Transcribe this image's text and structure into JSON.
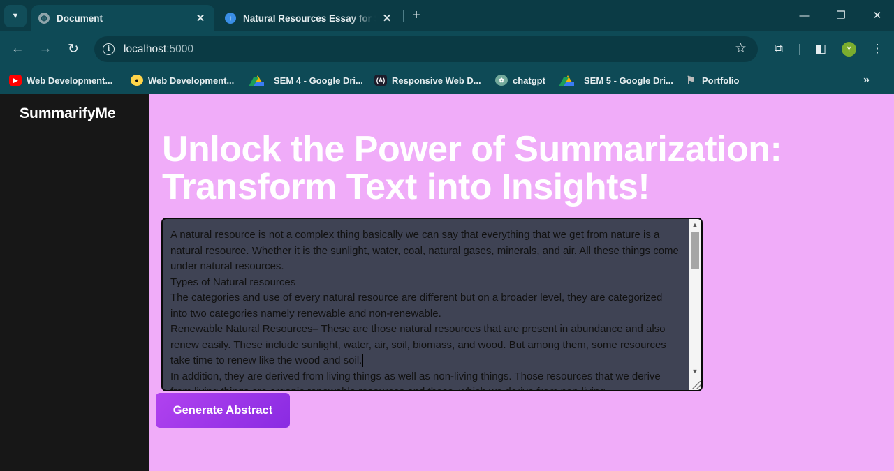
{
  "browser": {
    "tabs": [
      {
        "title": "Document",
        "active": true,
        "favicon": "globe-icon"
      },
      {
        "title": "Natural Resources Essay for Stu",
        "active": false,
        "favicon": "upload-arrow-icon"
      }
    ],
    "address": {
      "host": "localhost",
      "port": ":5000"
    },
    "avatar_letter": "Y",
    "bookmarks": [
      {
        "label": "Web Development...",
        "icon": "youtube-icon"
      },
      {
        "label": "Web Development...",
        "icon": "bookmark-favicon-icon"
      },
      {
        "label": "SEM 4 - Google Dri...",
        "icon": "google-drive-icon"
      },
      {
        "label": "Responsive Web D...",
        "icon": "responsive-web-icon"
      },
      {
        "label": "chatgpt",
        "icon": "chatgpt-icon"
      },
      {
        "label": "SEM 5 - Google Dri...",
        "icon": "google-drive-icon"
      },
      {
        "label": "Portfolio",
        "icon": "portfolio-icon"
      }
    ],
    "colors": {
      "chrome": "#0e4a56",
      "tabstrip": "#0b3b45"
    }
  },
  "app": {
    "brand": "SummarifyMe",
    "heading": "Unlock the Power of Summarization: Transform Text into Insights!",
    "textarea_value": "A natural resource is not a complex thing basically we can say that everything that we get from nature is a natural resource. Whether it is the sunlight, water, coal, natural gases, minerals, and air. All these things come under natural resources.\nTypes of Natural resources\nThe categories and use of every natural resource are different but on a broader level, they are categorized into two categories namely renewable and non-renewable.\nRenewable Natural Resources– These are those natural resources that are present in abundance and also renew easily. These include sunlight, water, air, soil, biomass, and wood. But among them, some resources take time to renew like the wood and soil.",
    "textarea_value_after_caret": "\nIn addition, they are derived from living things as well as non-living things. Those resources that we derive from living things are organic renewable resources and those, which we derive from non-living",
    "generate_button": "Generate Abstract",
    "colors": {
      "page_bg": "#f0acf9",
      "sidebar_bg": "#171717",
      "button": "#9b35e8",
      "textarea_bg": "#3f4354"
    }
  }
}
